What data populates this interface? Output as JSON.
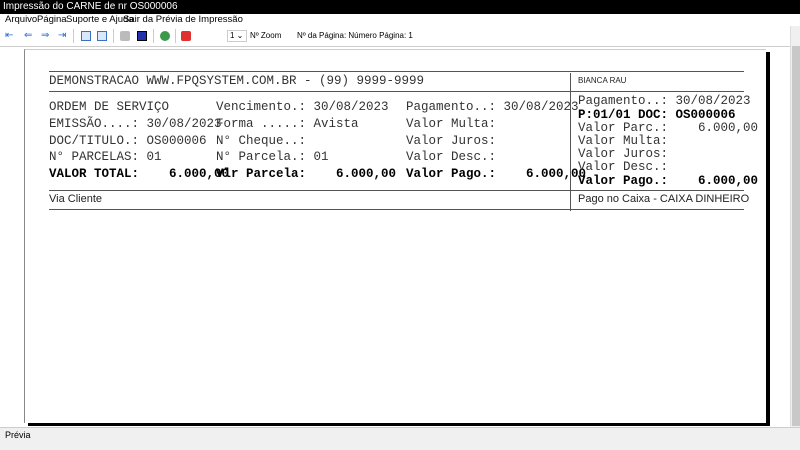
{
  "window": {
    "title": "Impressão do CARNE de nr OS000006"
  },
  "menu": [
    "Arquivo",
    "Página",
    "Suporte e Ajuda",
    "Sair da Prévia de Impressão"
  ],
  "toolbar": {
    "zoom_value": "1",
    "zoom_label": "Nº Zoom",
    "page_info": "Nº da Página: Número Página: 1"
  },
  "receipt": {
    "header": "DEMONSTRACAO WWW.FPQSYSTEM.COM.BR - (99) 9999-9999",
    "client_name": "BIANCA RAU",
    "col1": [
      "ORDEM DE SERVIÇO",
      "EMISSÃO....: 30/08/2023",
      "DOC/TITULO.: OS000006",
      "N° PARCELAS: 01",
      "VALOR TOTAL:    6.000,00"
    ],
    "col2": [
      "Vencimento.: 30/08/2023",
      "Forma .....: Avista",
      "N° Cheque..:",
      "N° Parcela.: 01",
      "Vlr Parcela:    6.000,00"
    ],
    "col3": [
      "Pagamento..: 30/08/2023",
      "Valor Multa:",
      "Valor Juros:",
      "Valor Desc.:",
      "Valor Pago.:    6.000,00"
    ],
    "stub": [
      "Pagamento..: 30/08/2023",
      "P:01/01 DOC: OS000006",
      "Valor Parc.:    6.000,00",
      "Valor Multa:",
      "Valor Juros:",
      "Valor Desc.:",
      "Valor Pago.:    6.000,00"
    ],
    "via": "Via Cliente",
    "payment_note": "Pago no Caixa - CAIXA DINHEIRO"
  },
  "status": {
    "text": "Prévia"
  }
}
